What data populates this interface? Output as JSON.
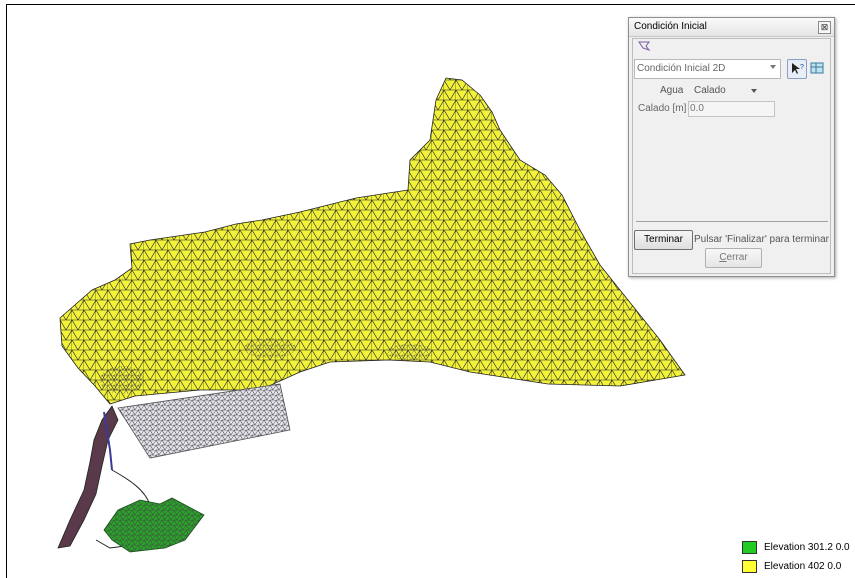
{
  "dialog": {
    "title": "Condición Inicial",
    "close_glyph": "⊠",
    "condition_select": {
      "value": "Condición Inicial 2D"
    },
    "water": {
      "label": "Agua",
      "value": "Calado"
    },
    "depth": {
      "label": "Calado [m]",
      "value": "0.0"
    },
    "terminate_label": "Terminar",
    "status_message": "Pulsar 'Finalizar' para terminar la",
    "close_label_prefix": "",
    "close_label_underlined": "C",
    "close_label_rest": "errar"
  },
  "legend": [
    {
      "label": "Elevation 301.2 0.0",
      "color": "#22cc22"
    },
    {
      "label": "Elevation 402 0.0",
      "color": "#ffff33"
    }
  ],
  "colors": {
    "mesh_fill": "#f2f23a",
    "mesh_lines": "#222222",
    "green_mesh": "#2aa12a",
    "gray_mesh": "#d8d8e0",
    "channel": "#3a3a9a"
  }
}
